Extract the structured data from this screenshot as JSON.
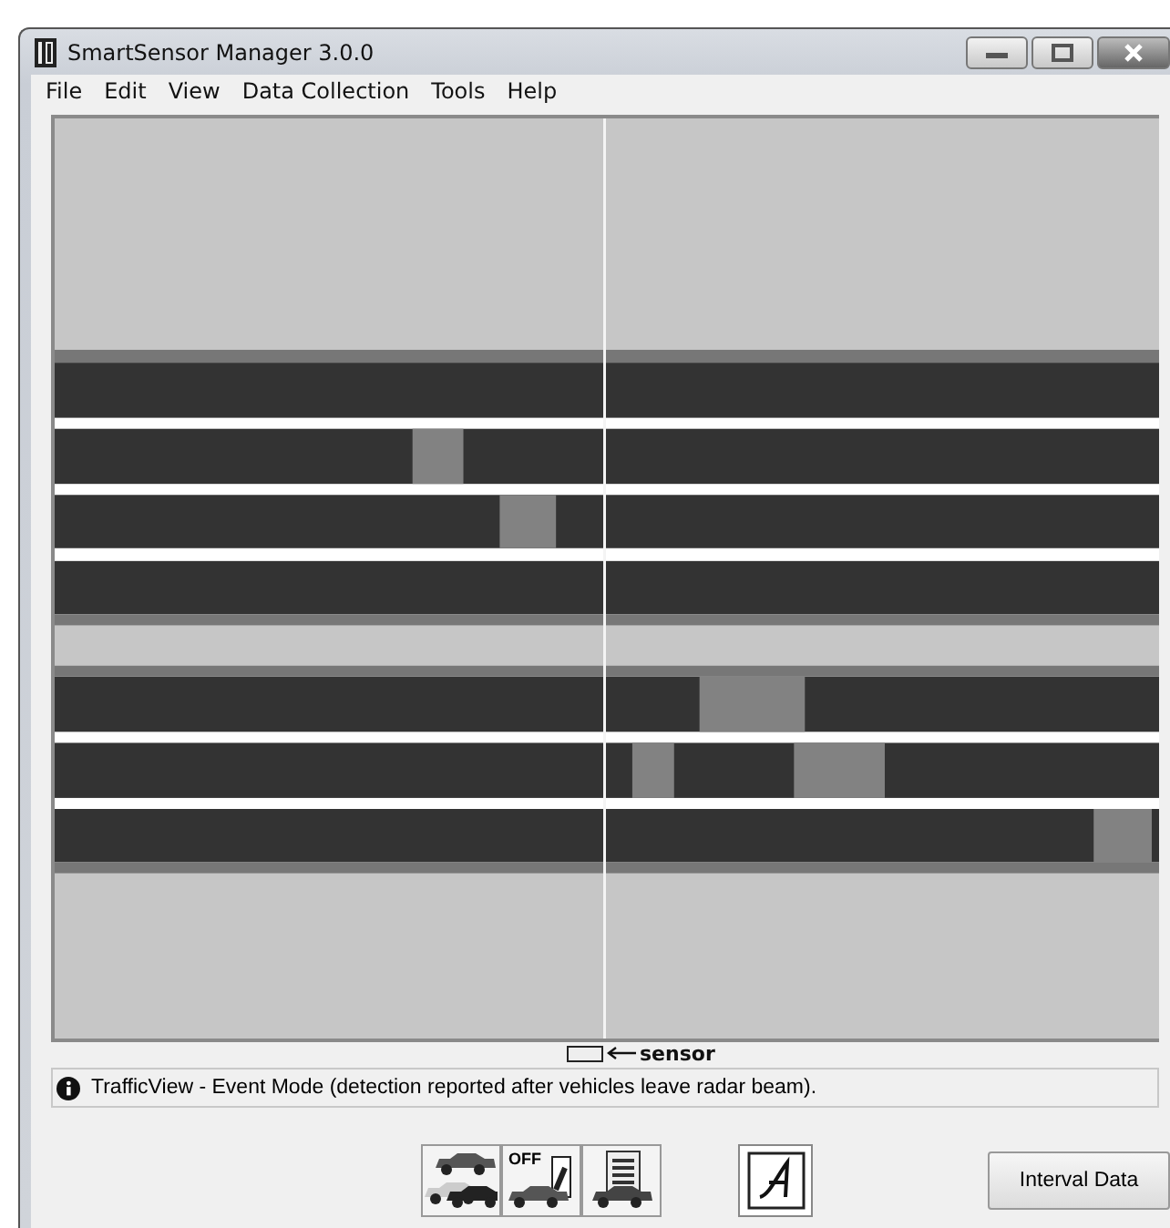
{
  "window": {
    "title": "SmartSensor Manager 3.0.0"
  },
  "menu": [
    "File",
    "Edit",
    "View",
    "Data Collection",
    "Tools",
    "Help"
  ],
  "traffic_view": {
    "sensor_label": "sensor"
  },
  "status_bar": {
    "message": "TrafficView - Event Mode (detection reported after vehicles leave radar beam)."
  },
  "toolbar": {
    "mode_labels": [
      "OFF"
    ],
    "buttons": [
      "Interval Data"
    ]
  }
}
